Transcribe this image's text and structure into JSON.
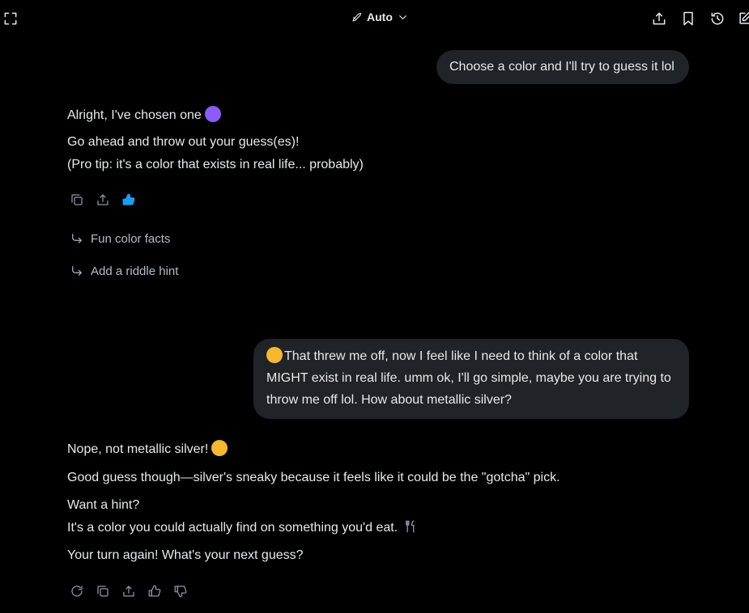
{
  "header": {
    "mode_label": "Auto",
    "icons": [
      "expand-icon",
      "rocket-icon",
      "chevron-down-icon",
      "share-icon",
      "bookmark-icon",
      "history-icon",
      "edit-icon"
    ]
  },
  "conversation": {
    "user_msg_1": "Choose a color and I'll try to guess it lol",
    "assistant_1": {
      "line1": "Alright, I've chosen one",
      "line2": "Go ahead and throw out your guess(es)!",
      "line3": "(Pro tip: it's a color that exists in real life... probably)"
    },
    "suggestions": [
      "Fun color facts",
      "Add a riddle hint"
    ],
    "user_msg_2": "That threw me off, now I feel like I need to think of a color that MIGHT exist in real life. umm ok, I'll go simple, maybe you are trying to throw me off lol. How about metallic silver?",
    "assistant_2": {
      "line1": "Nope, not metallic silver!",
      "line2": "Good guess though—silver's sneaky because it feels like it could be the \"gotcha\" pick.",
      "line3": "Want a hint?",
      "line4": "It's a color you could actually find on something you'd eat.",
      "line5": "Your turn again! What's your next guess?"
    }
  },
  "colors": {
    "background": "#000000",
    "bubble": "#202327",
    "text": "#e7e9ea",
    "muted_icon": "#8b98a5",
    "like_active": "#1d9bf0",
    "devil_emoji": "#8b5cf6",
    "smirk_emoji": "#f5b82e"
  }
}
